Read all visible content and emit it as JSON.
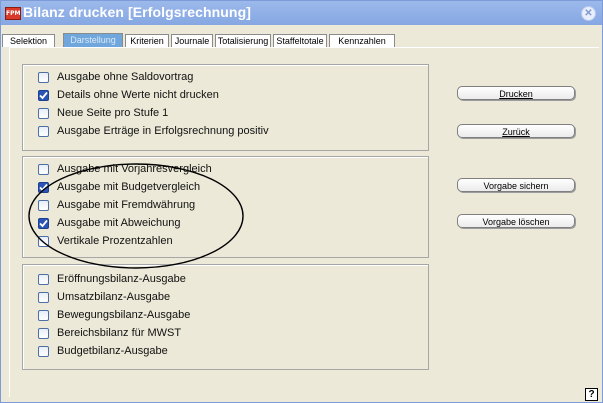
{
  "window": {
    "title": "Bilanz drucken [Erfolgsrechnung]",
    "app_icon": "FPM"
  },
  "tabs": [
    {
      "label": "Selektion"
    },
    {
      "label": "Darstellung"
    },
    {
      "label": "Kriterien"
    },
    {
      "label": "Journale"
    },
    {
      "label": "Totalisierung"
    },
    {
      "label": "Staffeltotale"
    },
    {
      "label": "Kennzahlen"
    }
  ],
  "active_tab": "Darstellung",
  "groups": [
    {
      "options": [
        {
          "label": "Ausgabe ohne Saldovortrag",
          "checked": false
        },
        {
          "label": "Details ohne Werte nicht drucken",
          "checked": true
        },
        {
          "label": "Neue Seite pro Stufe 1",
          "checked": false
        },
        {
          "label": "Ausgabe Erträge in Erfolgsrechnung positiv",
          "checked": false
        }
      ]
    },
    {
      "options": [
        {
          "label": "Ausgabe mit Vorjahresvergleich",
          "checked": false
        },
        {
          "label": "Ausgabe mit Budgetvergleich",
          "checked": true
        },
        {
          "label": "Ausgabe mit Fremdwährung",
          "checked": false
        },
        {
          "label": "Ausgabe mit Abweichung",
          "checked": true
        },
        {
          "label": "Vertikale Prozentzahlen",
          "checked": false
        }
      ]
    },
    {
      "options": [
        {
          "label": "Eröffnungsbilanz-Ausgabe",
          "checked": false
        },
        {
          "label": "Umsatzbilanz-Ausgabe",
          "checked": false
        },
        {
          "label": "Bewegungsbilanz-Ausgabe",
          "checked": false
        },
        {
          "label": "Bereichsbilanz für MWST",
          "checked": false
        },
        {
          "label": "Budgetbilanz-Ausgabe",
          "checked": false
        }
      ]
    }
  ],
  "buttons": {
    "drucken": "Drucken",
    "zurueck": "Zurück",
    "vorgabe_sichern": "Vorgabe sichern",
    "vorgabe_loeschen": "Vorgabe löschen",
    "help": "?"
  },
  "colors": {
    "titlebar": "#8eaee6",
    "active_tab": "#6fa6db",
    "checkbox_checked": "#2a55b7"
  }
}
